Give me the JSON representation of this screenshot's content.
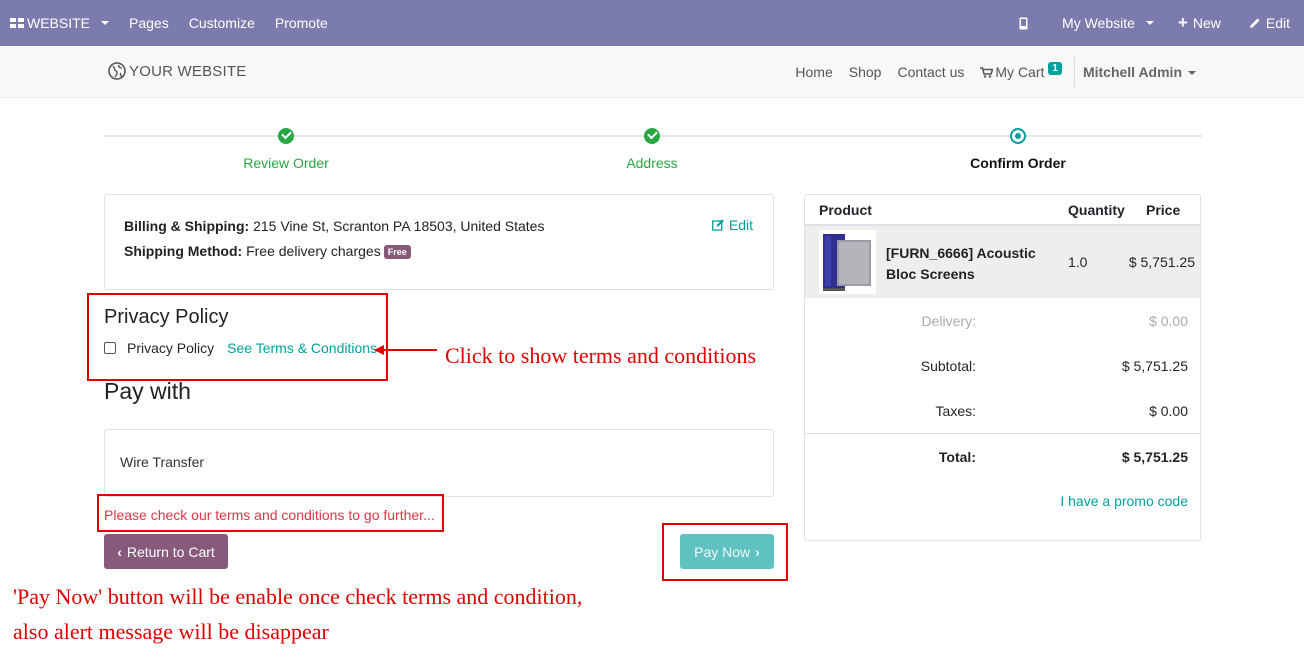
{
  "topbar": {
    "website_label": "WEBSITE",
    "menu_items": [
      "Pages",
      "Customize",
      "Promote"
    ],
    "my_website_label": "My Website",
    "new_label": "New",
    "edit_label": "Edit",
    "bg_color": "#7c7bad"
  },
  "navbar": {
    "brand": "YOUR WEBSITE",
    "links": [
      "Home",
      "Shop",
      "Contact us"
    ],
    "cart_label": "My Cart",
    "cart_count": "1",
    "user": "Mitchell Admin"
  },
  "wizard": {
    "steps": [
      {
        "label": "Review Order",
        "state": "done"
      },
      {
        "label": "Address",
        "state": "done"
      },
      {
        "label": "Confirm Order",
        "state": "current"
      }
    ]
  },
  "address": {
    "billing_label": "Billing & Shipping:",
    "billing_value": " 215 Vine St, Scranton PA 18503, United States",
    "shipping_label": "Shipping Method:",
    "shipping_value": " Free delivery charges",
    "free_badge": "Free",
    "edit_label": "Edit"
  },
  "privacy": {
    "title": "Privacy Policy",
    "checkbox_label": "Privacy Policy",
    "terms_link": "See Terms & Conditions",
    "checked": false
  },
  "payment": {
    "title": "Pay with",
    "method": "Wire Transfer",
    "alert": "Please check our terms and conditions to go further...",
    "return_label": "Return to Cart",
    "pay_label": "Pay Now"
  },
  "cart": {
    "headers": {
      "product": "Product",
      "quantity": "Quantity",
      "price": "Price"
    },
    "item": {
      "name": "[FURN_6666] Acoustic Bloc Screens",
      "qty": "1.0",
      "price": "$ 5,751.25"
    },
    "delivery_label": "Delivery:",
    "delivery_value": "$ 0.00",
    "subtotal_label": "Subtotal:",
    "subtotal_value": "$ 5,751.25",
    "taxes_label": "Taxes:",
    "taxes_value": "$ 0.00",
    "total_label": "Total:",
    "total_value": "$ 5,751.25",
    "promo": "I have a promo code"
  },
  "annotations": {
    "terms_note": "Click to show terms and conditions",
    "pay_note_line1": "'Pay Now' button will be enable once check terms and condition,",
    "pay_note_line2": "also alert message will be disappear"
  }
}
